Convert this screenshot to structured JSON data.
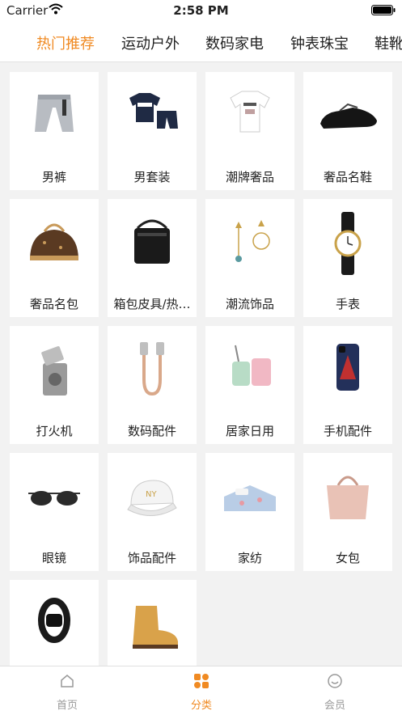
{
  "status": {
    "carrier": "Carrier",
    "time": "2:58 PM"
  },
  "tabs": [
    {
      "label": "热门推荐",
      "active": true
    },
    {
      "label": "运动户外",
      "active": false
    },
    {
      "label": "数码家电",
      "active": false
    },
    {
      "label": "钟表珠宝",
      "active": false
    },
    {
      "label": "鞋靴",
      "active": false
    }
  ],
  "categories": [
    {
      "label": "男裤",
      "icon": "pants-icon"
    },
    {
      "label": "男套装",
      "icon": "tshirt-shorts-set-icon"
    },
    {
      "label": "潮牌奢品",
      "icon": "white-tshirt-icon"
    },
    {
      "label": "奢品名鞋",
      "icon": "leather-shoe-icon"
    },
    {
      "label": "奢品名包",
      "icon": "luxury-handbag-icon"
    },
    {
      "label": "箱包皮具/热…",
      "icon": "shoulder-bag-icon"
    },
    {
      "label": "潮流饰品",
      "icon": "earrings-icon"
    },
    {
      "label": "手表",
      "icon": "wristwatch-icon"
    },
    {
      "label": "打火机",
      "icon": "lighter-icon"
    },
    {
      "label": "数码配件",
      "icon": "usb-cable-icon"
    },
    {
      "label": "居家日用",
      "icon": "toothbrush-cup-icon"
    },
    {
      "label": "手机配件",
      "icon": "phone-case-icon"
    },
    {
      "label": "眼镜",
      "icon": "sunglasses-icon"
    },
    {
      "label": "饰品配件",
      "icon": "baseball-cap-icon"
    },
    {
      "label": "家纺",
      "icon": "bedding-icon"
    },
    {
      "label": "女包",
      "icon": "pink-tote-bag-icon"
    },
    {
      "label": "",
      "icon": "fitness-band-icon"
    },
    {
      "label": "",
      "icon": "work-boot-icon"
    }
  ],
  "bottom_nav": [
    {
      "label": "首页",
      "icon": "home-icon",
      "active": false
    },
    {
      "label": "分类",
      "icon": "category-grid-icon",
      "active": true
    },
    {
      "label": "会员",
      "icon": "smile-icon",
      "active": false
    }
  ],
  "colors": {
    "accent": "#f08a22",
    "inactive": "#999999",
    "background": "#f2f2f2"
  }
}
